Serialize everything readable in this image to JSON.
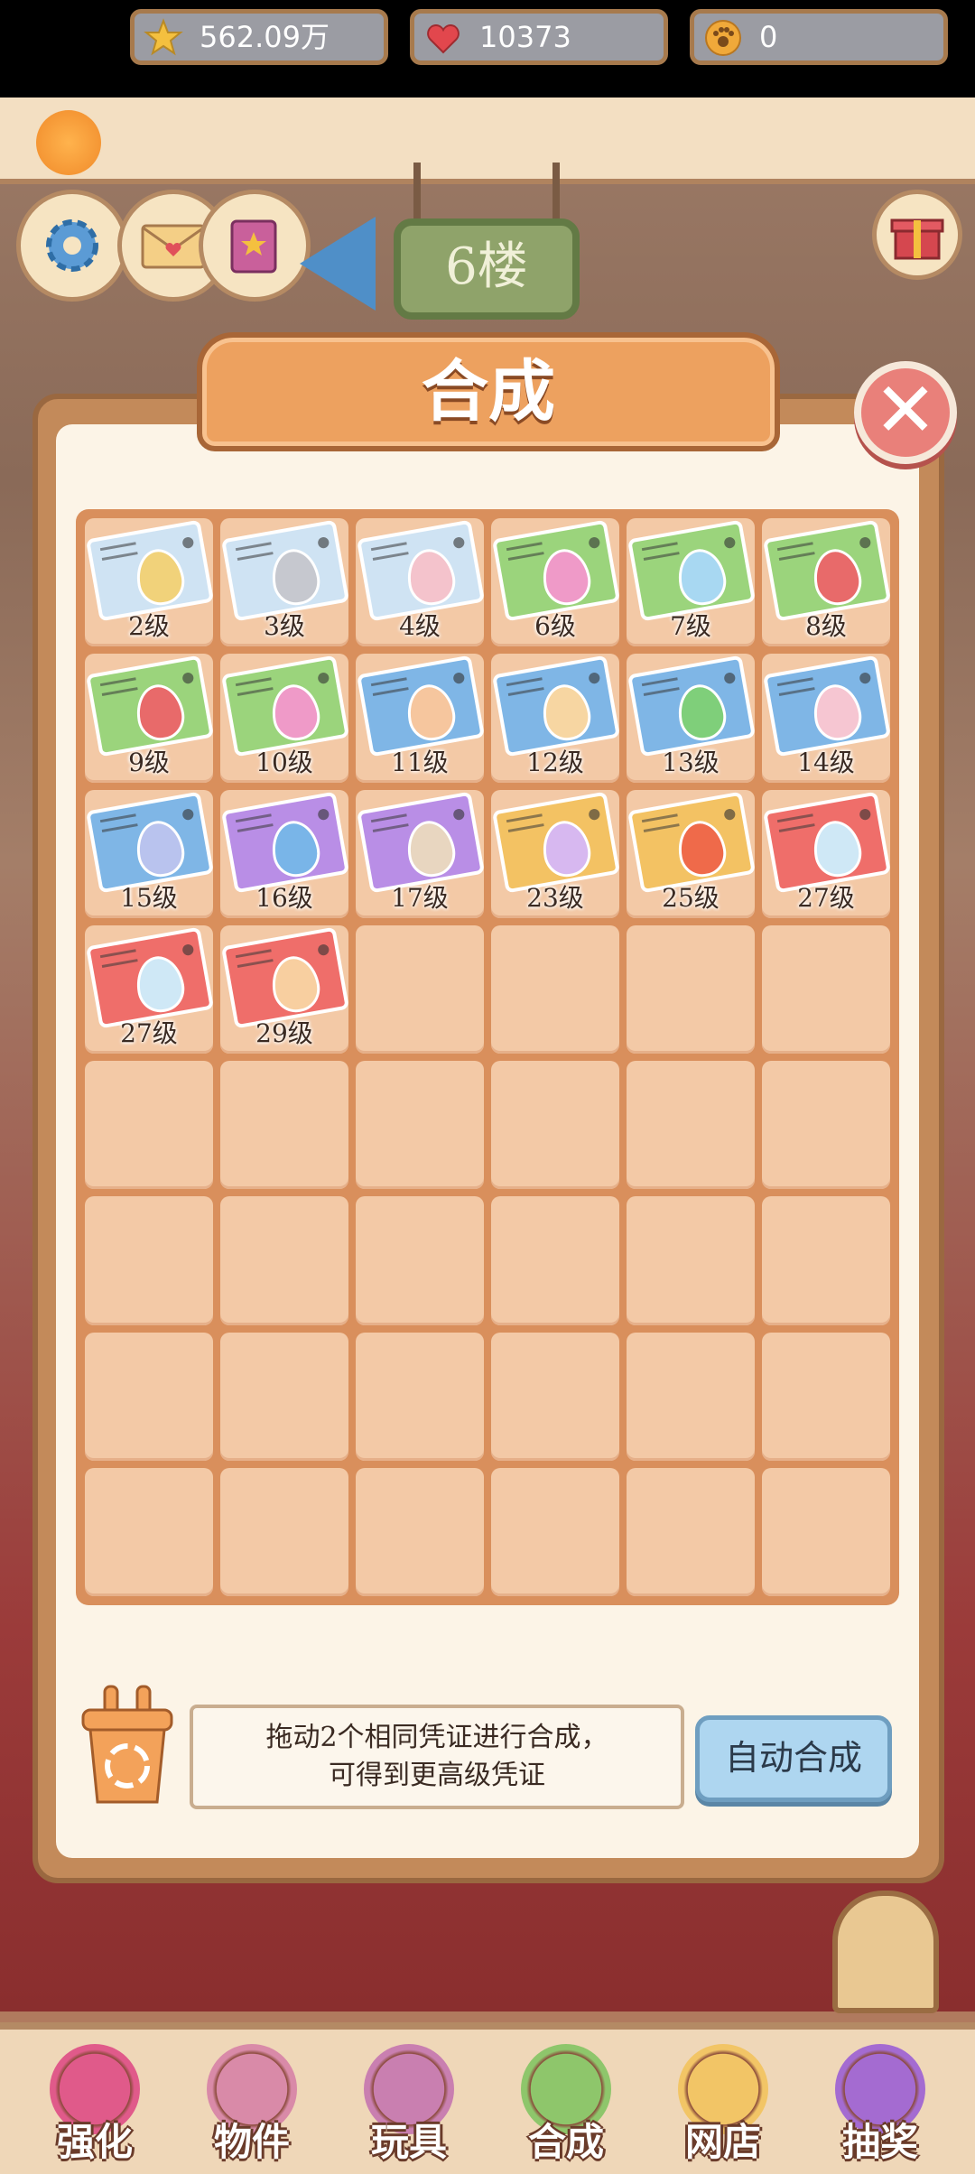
{
  "resources": {
    "stars": "562.09万",
    "hearts": "10373",
    "coins": "0"
  },
  "floor": "6楼",
  "panel": {
    "title": "合成",
    "hint_line1": "拖动2个相同凭证进行合成，",
    "hint_line2": "可得到更高级凭证",
    "auto_button": "自动合成"
  },
  "cards": [
    {
      "label": "2级",
      "card_color": "#cfe3f3",
      "egg_color": "#f1d27a"
    },
    {
      "label": "3级",
      "card_color": "#cfe3f3",
      "egg_color": "#c6c8cf"
    },
    {
      "label": "4级",
      "card_color": "#cfe3f3",
      "egg_color": "#f4c3cc"
    },
    {
      "label": "6级",
      "card_color": "#9bd47c",
      "egg_color": "#ef9ac8"
    },
    {
      "label": "7级",
      "card_color": "#9bd47c",
      "egg_color": "#a8d8f2"
    },
    {
      "label": "8级",
      "card_color": "#9bd47c",
      "egg_color": "#e86a6a"
    },
    {
      "label": "9级",
      "card_color": "#9bd47c",
      "egg_color": "#e86a6a"
    },
    {
      "label": "10级",
      "card_color": "#9bd47c",
      "egg_color": "#ef9ac8"
    },
    {
      "label": "11级",
      "card_color": "#7fb6e6",
      "egg_color": "#f6c69e"
    },
    {
      "label": "12级",
      "card_color": "#7fb6e6",
      "egg_color": "#f7d6a2"
    },
    {
      "label": "13级",
      "card_color": "#7fb6e6",
      "egg_color": "#7fcf7a"
    },
    {
      "label": "14级",
      "card_color": "#7fb6e6",
      "egg_color": "#f6c6d2"
    },
    {
      "label": "15级",
      "card_color": "#7fb6e6",
      "egg_color": "#b9c3ee"
    },
    {
      "label": "16级",
      "card_color": "#b98ee6",
      "egg_color": "#79b5e8"
    },
    {
      "label": "17级",
      "card_color": "#b98ee6",
      "egg_color": "#e8d6c0"
    },
    {
      "label": "23级",
      "card_color": "#f3c263",
      "egg_color": "#d7b8f0"
    },
    {
      "label": "25级",
      "card_color": "#f3c263",
      "egg_color": "#ef6a4a"
    },
    {
      "label": "27级",
      "card_color": "#ef6e6a",
      "egg_color": "#cfe8f6"
    },
    {
      "label": "27级",
      "card_color": "#ef6e6a",
      "egg_color": "#cfe8f6"
    },
    {
      "label": "29级",
      "card_color": "#ef6e6a",
      "egg_color": "#f8cfa0"
    }
  ],
  "empty_slots": 28,
  "nav": [
    {
      "label": "强化",
      "icon": "lollipop-icon",
      "color": "#e05a8a"
    },
    {
      "label": "物件",
      "icon": "piano-icon",
      "color": "#d98aa8"
    },
    {
      "label": "玩具",
      "icon": "toy-house-icon",
      "color": "#c97fb0"
    },
    {
      "label": "合成",
      "icon": "cards-icon",
      "color": "#8ec66b"
    },
    {
      "label": "网店",
      "icon": "shop-icon",
      "color": "#f2c566"
    },
    {
      "label": "抽奖",
      "icon": "wheel-icon",
      "color": "#a46bd1"
    }
  ],
  "colors": {
    "panel_border": "#c38a5a",
    "title_plate": "#eda15f",
    "close_button": "#e9807a",
    "auto_button": "#aed6f0",
    "slot": "#f3c9a6"
  }
}
